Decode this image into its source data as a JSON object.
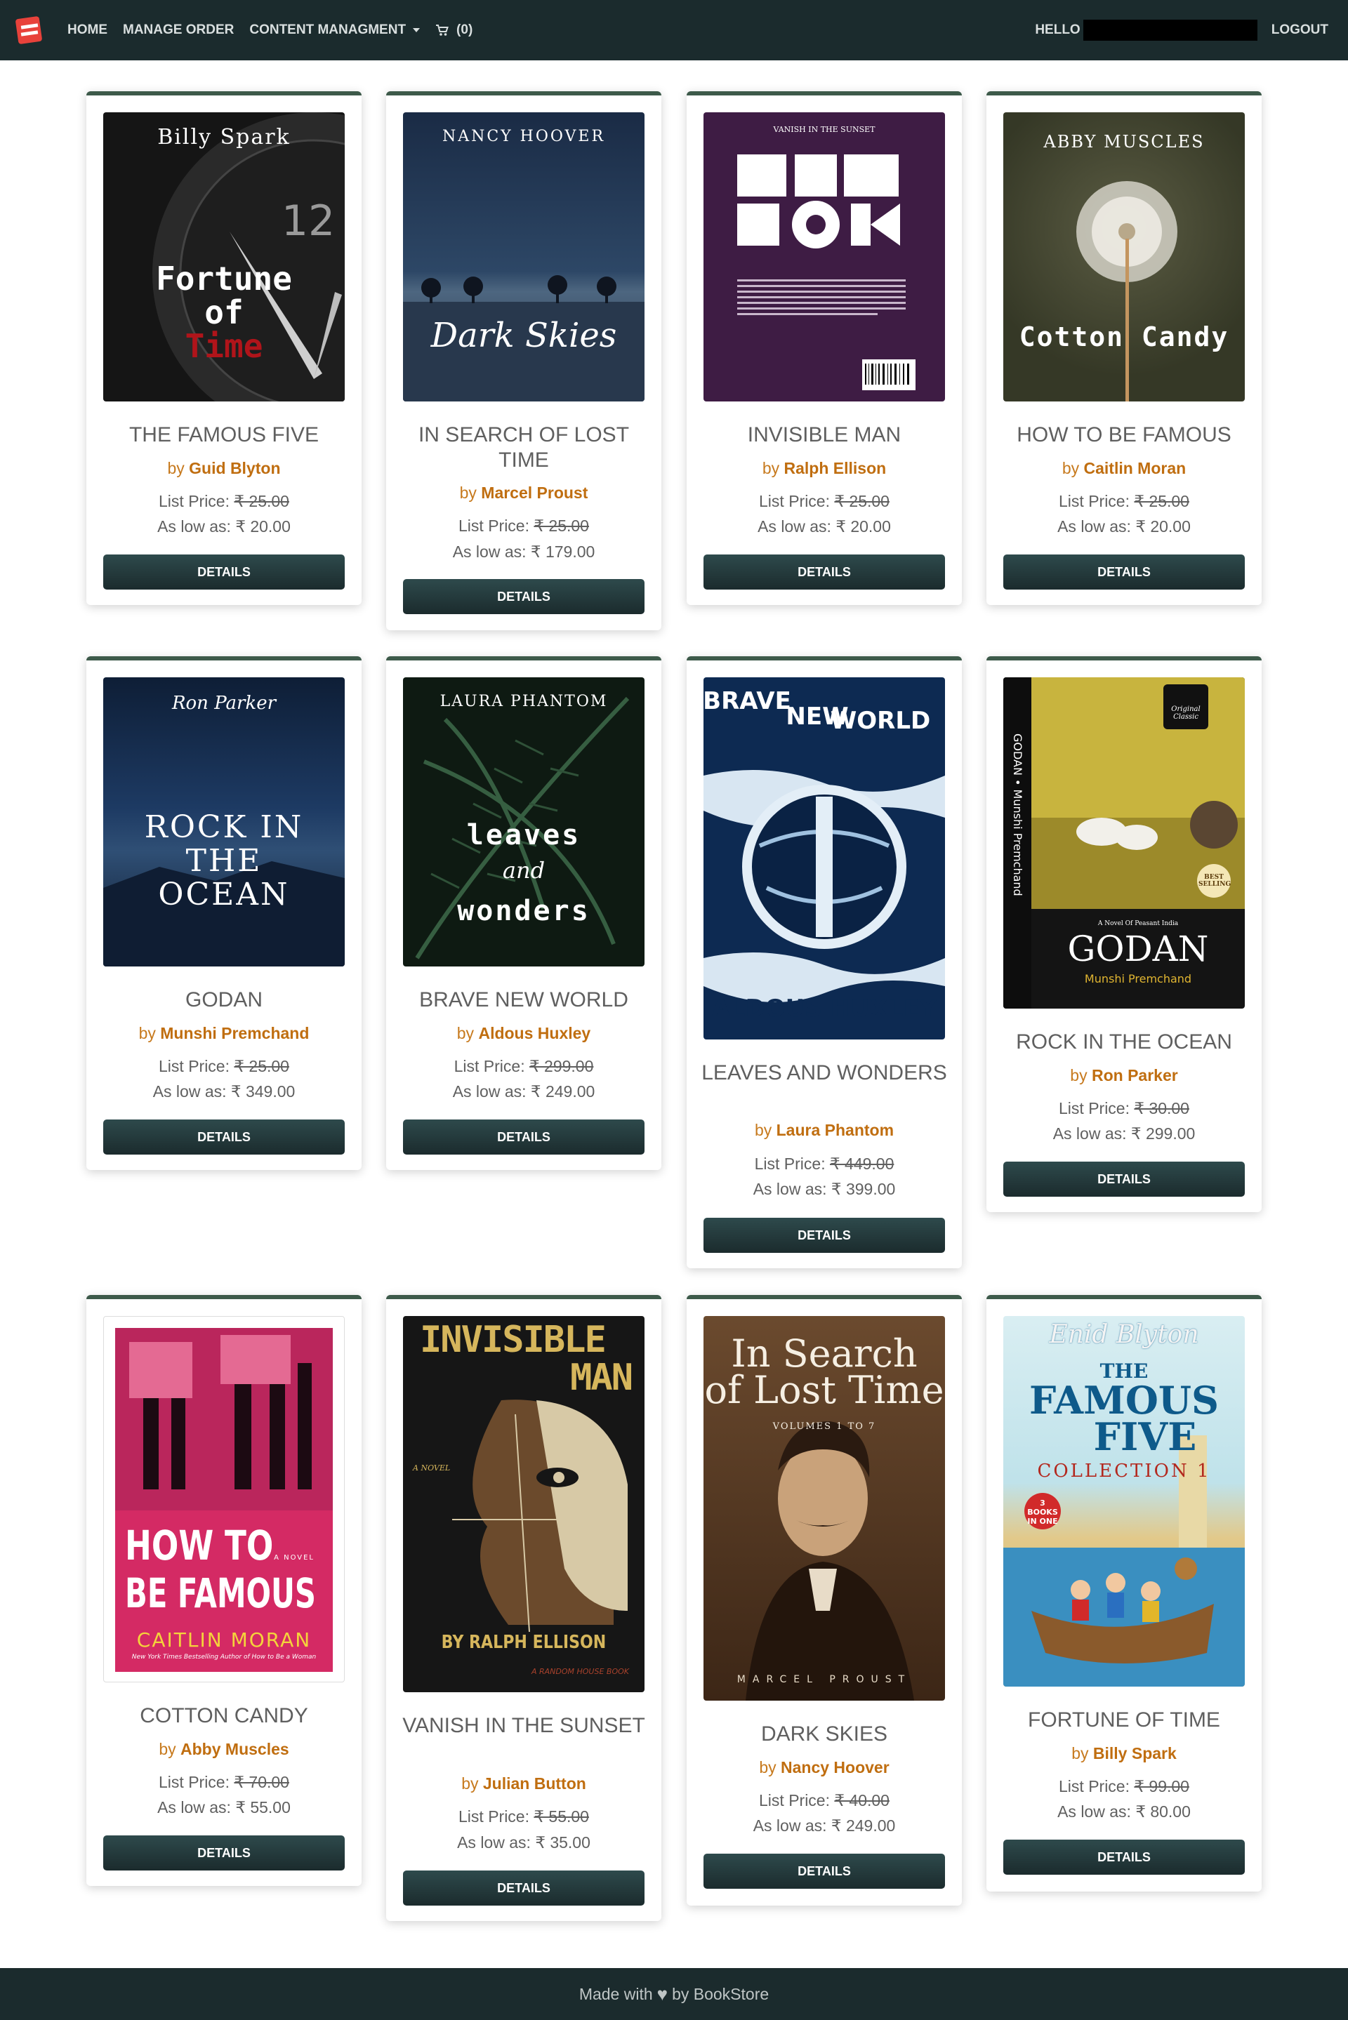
{
  "nav": {
    "home": "HOME",
    "manage_order": "MANAGE ORDER",
    "content": "CONTENT MANAGMENT",
    "cart_count": "(0)",
    "hello": "HELLO",
    "logout": "LOGOUT"
  },
  "books": [
    {
      "title": "THE FAMOUS FIVE",
      "by": "by",
      "author": "Guid Blyton",
      "list_label": "List Price:",
      "list_price": "₹ 25.00",
      "low_label": "As low as:",
      "low_price": "₹ 20.00",
      "button": "DETAILS",
      "cover": {
        "top": "Billy Spark",
        "main": "Fortune of Time",
        "line1": "Fortune",
        "line2": "of",
        "line3": "Time",
        "clock": "12"
      }
    },
    {
      "title": "IN SEARCH OF LOST TIME",
      "by": "by",
      "author": "Marcel Proust",
      "list_label": "List Price:",
      "list_price": "₹ 25.00",
      "low_label": "As low as:",
      "low_price": "₹ 179.00",
      "button": "DETAILS",
      "cover": {
        "top": "NANCY HOOVER",
        "main": "Dark Skies"
      }
    },
    {
      "title": "INVISIBLE MAN",
      "by": "by",
      "author": "Ralph Ellison",
      "list_label": "List Price:",
      "list_price": "₹ 25.00",
      "low_label": "As low as:",
      "low_price": "₹ 20.00",
      "button": "DETAILS",
      "cover": {
        "top": "VANISH IN THE SUNSET",
        "main": "BOOK"
      }
    },
    {
      "title": "HOW TO BE FAMOUS",
      "by": "by",
      "author": "Caitlin Moran",
      "list_label": "List Price:",
      "list_price": "₹ 25.00",
      "low_label": "As low as:",
      "low_price": "₹ 20.00",
      "button": "DETAILS",
      "cover": {
        "top": "ABBY MUSCLES",
        "main": "Cotton Candy"
      }
    },
    {
      "title": "GODAN",
      "by": "by",
      "author": "Munshi Premchand",
      "list_label": "List Price:",
      "list_price": "₹ 25.00",
      "low_label": "As low as:",
      "low_price": "₹ 349.00",
      "button": "DETAILS",
      "cover": {
        "top": "Ron Parker",
        "main": "ROCK IN THE OCEAN",
        "line1": "ROCK IN",
        "line2": "THE",
        "line3": "OCEAN"
      }
    },
    {
      "title": "BRAVE NEW WORLD",
      "by": "by",
      "author": "Aldous Huxley",
      "list_label": "List Price:",
      "list_price": "₹ 299.00",
      "low_label": "As low as:",
      "low_price": "₹ 249.00",
      "button": "DETAILS",
      "cover": {
        "top": "LAURA PHANTOM",
        "main": "leaves and wonders",
        "line1": "leaves",
        "line2": "and",
        "line3": "wonders"
      }
    },
    {
      "title": "LEAVES AND WONDERS",
      "by": "by",
      "author": "Laura Phantom",
      "list_label": "List Price:",
      "list_price": "₹ 449.00",
      "low_label": "As low as:",
      "low_price": "₹ 399.00",
      "button": "DETAILS",
      "cover": {
        "top": "BRAVE NEW WORLD",
        "main": "ALDOUS HUXLEY",
        "line1": "BRAVE",
        "line2": "NEW",
        "line3": "WORLD"
      }
    },
    {
      "title": "ROCK IN THE OCEAN",
      "by": "by",
      "author": "Ron Parker",
      "list_label": "List Price:",
      "list_price": "₹ 30.00",
      "low_label": "As low as:",
      "low_price": "₹ 299.00",
      "button": "DETAILS",
      "cover": {
        "top": "GODAN",
        "main": "GODAN",
        "sub": "Munshi Premchand",
        "side": "GODAN • Munshi Premchand",
        "badge": "Original Classic",
        "best": "BEST SELLING",
        "novel": "A Novel Of Peasant India"
      }
    },
    {
      "title": "COTTON CANDY",
      "by": "by",
      "author": "Abby Muscles",
      "list_label": "List Price:",
      "list_price": "₹ 70.00",
      "low_label": "As low as:",
      "low_price": "₹ 55.00",
      "button": "DETAILS",
      "cover": {
        "top": "A NOVEL",
        "main": "HOW TO BE FAMOUS",
        "line1": "HOW TO",
        "line2": "BE FAMOUS",
        "sub": "CAITLIN MORAN",
        "tagline": "New York Times Bestselling Author of How to Be a Woman"
      }
    },
    {
      "title": "VANISH IN THE SUNSET",
      "by": "by",
      "author": "Julian Button",
      "list_label": "List Price:",
      "list_price": "₹ 55.00",
      "low_label": "As low as:",
      "low_price": "₹ 35.00",
      "button": "DETAILS",
      "cover": {
        "top": "A NOVEL",
        "main": "INVISIBLE MAN",
        "line1": "INVISIBLE",
        "line2": "MAN",
        "sub": "BY RALPH ELLISON",
        "tagline": "A RANDOM HOUSE BOOK"
      }
    },
    {
      "title": "DARK SKIES",
      "by": "by",
      "author": "Nancy Hoover",
      "list_label": "List Price:",
      "list_price": "₹ 40.00",
      "low_label": "As low as:",
      "low_price": "₹ 249.00",
      "button": "DETAILS",
      "cover": {
        "top": "VOLUMES 1 TO 7",
        "main": "In Search of Lost Time",
        "line1": "In Search",
        "line2": "of Lost Time",
        "sub": "MARCEL PROUST"
      }
    },
    {
      "title": "FORTUNE OF TIME",
      "by": "by",
      "author": "Billy Spark",
      "list_label": "List Price:",
      "list_price": "₹ 99.00",
      "low_label": "As low as:",
      "low_price": "₹ 80.00",
      "button": "DETAILS",
      "cover": {
        "top": "Enid Blyton",
        "main": "THE FAMOUS FIVE",
        "line1": "THE",
        "line2": "FAMOUS",
        "line3": "FIVE",
        "sub": "COLLECTION 1",
        "badge": "3 BOOKS IN ONE"
      }
    }
  ],
  "footer": {
    "made_with": "Made with",
    "by": "by BookStore"
  }
}
